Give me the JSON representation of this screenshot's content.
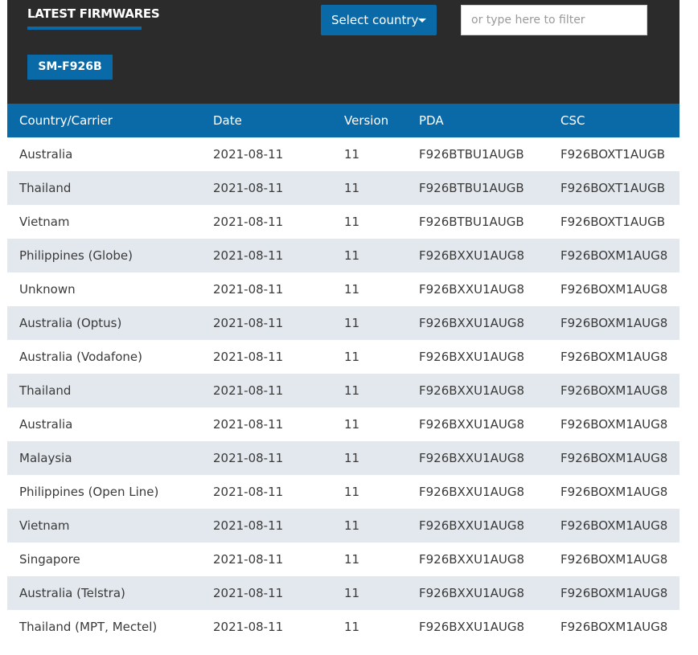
{
  "header": {
    "title": "LATEST FIRMWARES",
    "select_label": "Select country",
    "filter_placeholder": "or type here to filter",
    "filter_value": "",
    "model": "SM-F926B"
  },
  "colors": {
    "header_bg": "#2b2b2b",
    "accent": "#0a6aa8",
    "row_alt": "#e3e8ee"
  },
  "icons": {
    "select_caret": "caret-down-icon"
  },
  "table": {
    "columns": [
      "Country/Carrier",
      "Date",
      "Version",
      "PDA",
      "CSC"
    ],
    "rows": [
      [
        "Australia",
        "2021-08-11",
        "11",
        "F926BTBU1AUGB",
        "F926BOXT1AUGB"
      ],
      [
        "Thailand",
        "2021-08-11",
        "11",
        "F926BTBU1AUGB",
        "F926BOXT1AUGB"
      ],
      [
        "Vietnam",
        "2021-08-11",
        "11",
        "F926BTBU1AUGB",
        "F926BOXT1AUGB"
      ],
      [
        "Philippines (Globe)",
        "2021-08-11",
        "11",
        "F926BXXU1AUG8",
        "F926BOXM1AUG8"
      ],
      [
        "Unknown",
        "2021-08-11",
        "11",
        "F926BXXU1AUG8",
        "F926BOXM1AUG8"
      ],
      [
        "Australia (Optus)",
        "2021-08-11",
        "11",
        "F926BXXU1AUG8",
        "F926BOXM1AUG8"
      ],
      [
        "Australia (Vodafone)",
        "2021-08-11",
        "11",
        "F926BXXU1AUG8",
        "F926BOXM1AUG8"
      ],
      [
        "Thailand",
        "2021-08-11",
        "11",
        "F926BXXU1AUG8",
        "F926BOXM1AUG8"
      ],
      [
        "Australia",
        "2021-08-11",
        "11",
        "F926BXXU1AUG8",
        "F926BOXM1AUG8"
      ],
      [
        "Malaysia",
        "2021-08-11",
        "11",
        "F926BXXU1AUG8",
        "F926BOXM1AUG8"
      ],
      [
        "Philippines (Open Line)",
        "2021-08-11",
        "11",
        "F926BXXU1AUG8",
        "F926BOXM1AUG8"
      ],
      [
        "Vietnam",
        "2021-08-11",
        "11",
        "F926BXXU1AUG8",
        "F926BOXM1AUG8"
      ],
      [
        "Singapore",
        "2021-08-11",
        "11",
        "F926BXXU1AUG8",
        "F926BOXM1AUG8"
      ],
      [
        "Australia (Telstra)",
        "2021-08-11",
        "11",
        "F926BXXU1AUG8",
        "F926BOXM1AUG8"
      ],
      [
        "Thailand (MPT, Mectel)",
        "2021-08-11",
        "11",
        "F926BXXU1AUG8",
        "F926BOXM1AUG8"
      ]
    ]
  }
}
